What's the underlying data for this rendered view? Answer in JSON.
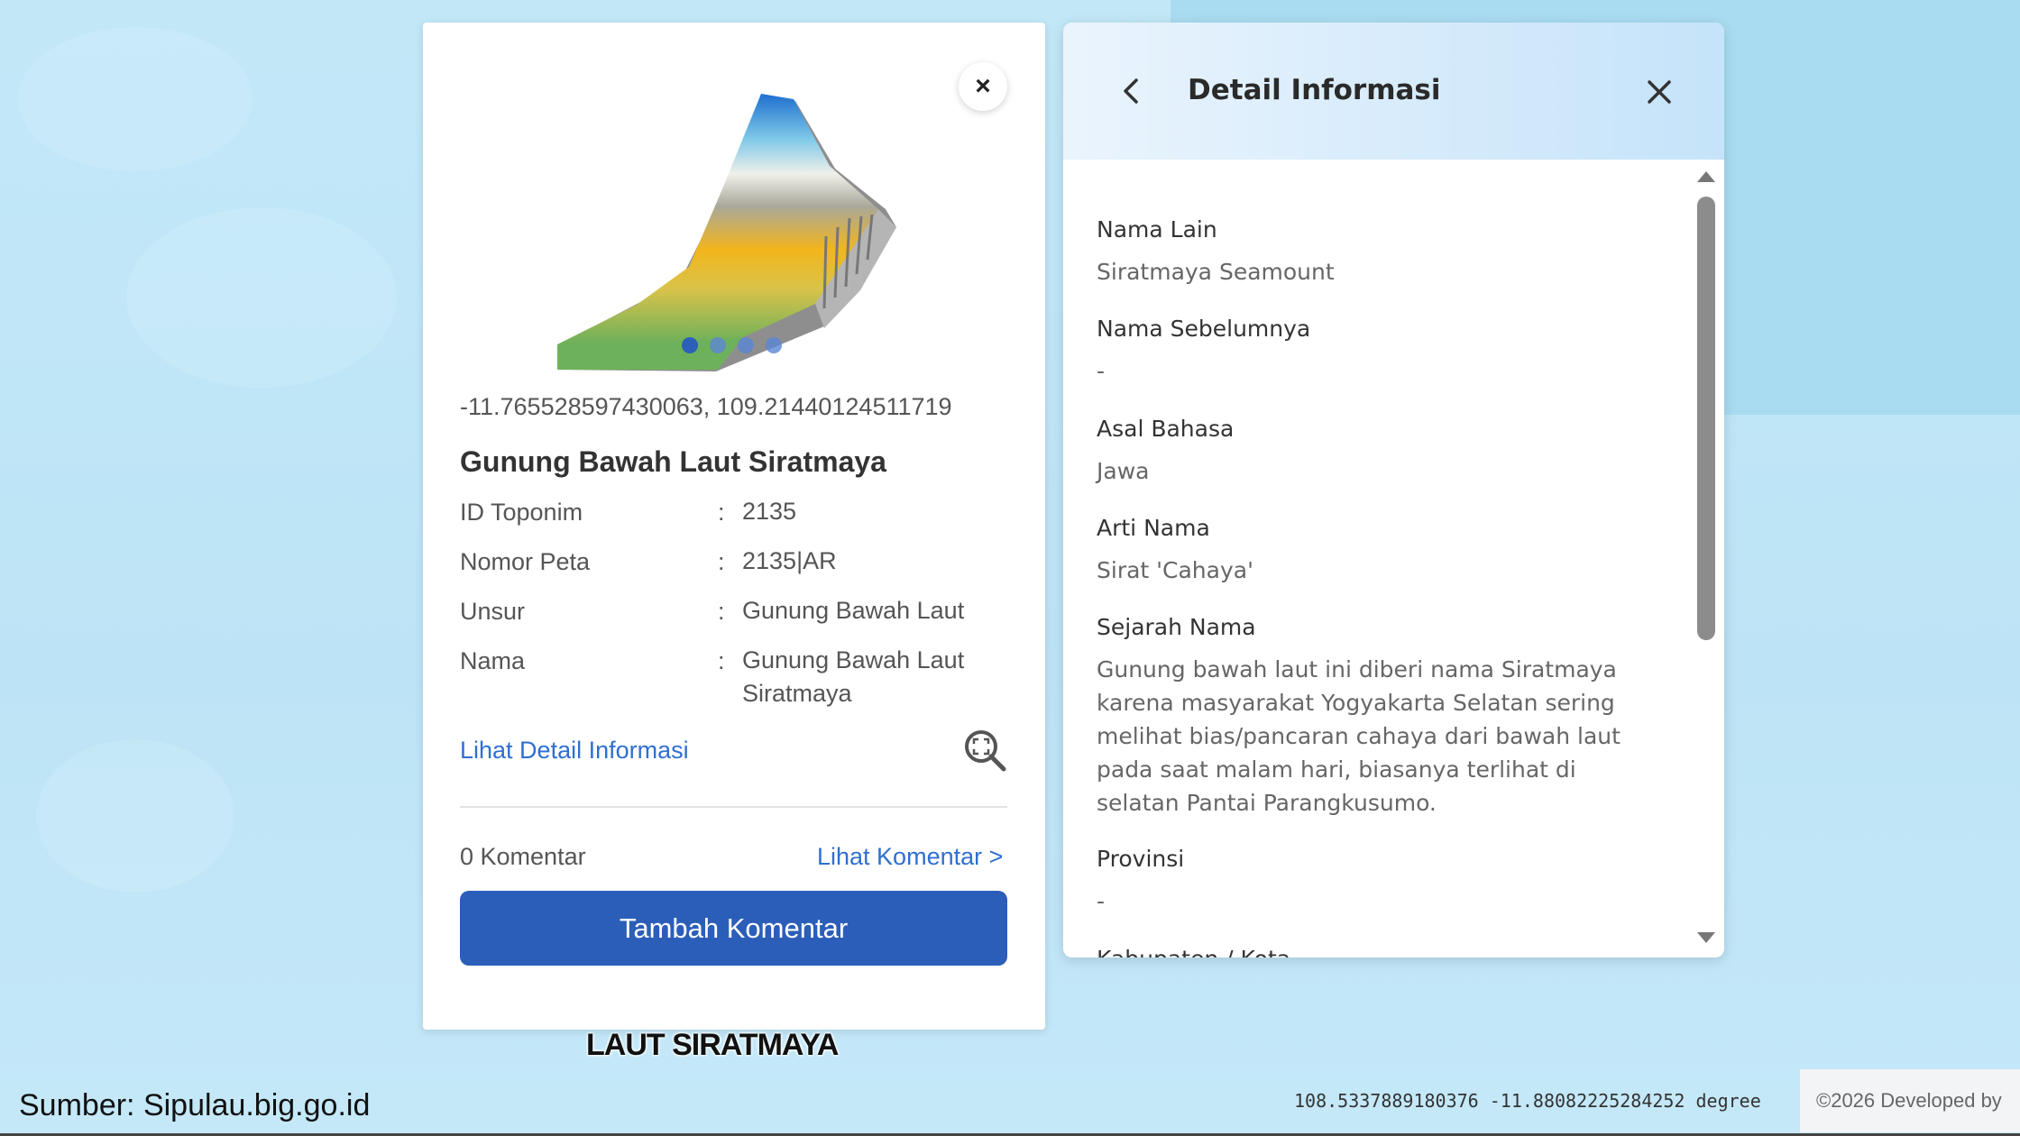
{
  "popup": {
    "coordinates": "-11.765528597430063, 109.21440124511719",
    "title": "Gunung Bawah Laut Siratmaya",
    "rows": [
      {
        "key": "ID Toponim",
        "sep": ":",
        "value": "2135"
      },
      {
        "key": "Nomor Peta",
        "sep": ":",
        "value": "2135|AR"
      },
      {
        "key": "Unsur",
        "sep": ":",
        "value": "Gunung Bawah Laut"
      },
      {
        "key": "Nama",
        "sep": ":",
        "value": "Gunung Bawah Laut Siratmaya"
      }
    ],
    "detail_link": "Lihat Detail Informasi",
    "comment_count": "0 Komentar",
    "comment_link": "Lihat Komentar >",
    "add_comment_label": "Tambah Komentar",
    "close_glyph": "×",
    "carousel": {
      "total": 4,
      "active": 0
    }
  },
  "map_label": "LAUT SIRATMAYA",
  "panel": {
    "title": "Detail Informasi",
    "fields": [
      {
        "label": "Nama Lain",
        "value": "Siratmaya Seamount"
      },
      {
        "label": "Nama Sebelumnya",
        "value": "-"
      },
      {
        "label": "Asal Bahasa",
        "value": "Jawa"
      },
      {
        "label": "Arti Nama",
        "value": "Sirat 'Cahaya'"
      },
      {
        "label": "Sejarah Nama",
        "value": "Gunung bawah laut ini diberi nama Siratmaya karena masyarakat Yogyakarta Selatan sering melihat bias/pancaran cahaya dari bawah laut pada saat malam hari, biasanya terlihat di selatan Pantai Parangkusumo."
      },
      {
        "label": "Provinsi",
        "value": "-"
      },
      {
        "label": "Kabupaten / Kota",
        "value": ""
      }
    ]
  },
  "footer": {
    "source": "Sumber: Sipulau.big.go.id",
    "cursor_coords": "108.5337889180376 -11.88082225284252 degree",
    "copyright": "©2026 Developed by"
  },
  "icons": {
    "back": "chevron-left-icon",
    "close": "close-icon",
    "zoom": "zoom-in-icon",
    "scroll_up": "caret-up-icon",
    "scroll_down": "caret-down-icon"
  },
  "colors": {
    "accent": "#2b5eb8",
    "link": "#2f6fd1",
    "map_water": "#bfe6f7"
  }
}
